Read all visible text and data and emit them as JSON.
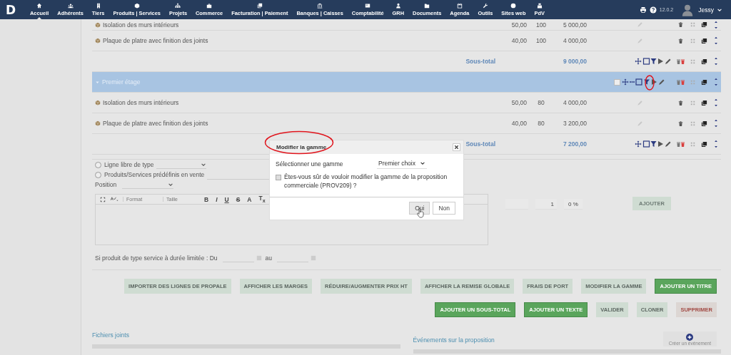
{
  "topbar": {
    "logo": "D",
    "menu": [
      {
        "label": "Accueil",
        "selected": true
      },
      {
        "label": "Adhérents",
        "selected": false
      },
      {
        "label": "Tiers",
        "selected": false
      },
      {
        "label": "Produits | Services",
        "selected": false
      },
      {
        "label": "Projets",
        "selected": false
      },
      {
        "label": "Commerce",
        "selected": false
      },
      {
        "label": "Facturation | Paiement",
        "selected": false
      },
      {
        "label": "Banques | Caisses",
        "selected": false
      },
      {
        "label": "Comptabilité",
        "selected": false
      },
      {
        "label": "GRH",
        "selected": false
      },
      {
        "label": "Documents",
        "selected": false
      },
      {
        "label": "Agenda",
        "selected": false
      },
      {
        "label": "Outils",
        "selected": false
      },
      {
        "label": "Sites web",
        "selected": false
      },
      {
        "label": "PdV",
        "selected": false
      }
    ],
    "version": "12.0.2",
    "user": "Jessy"
  },
  "table": {
    "rows": [
      {
        "kind": "product",
        "label": "Isolation des murs intérieurs",
        "qty": "50,00",
        "column_3": "100",
        "total": "5 000,00"
      },
      {
        "kind": "product",
        "label": "Plaque de platre avec finition des joints",
        "qty": "40,00",
        "column_3": "100",
        "total": "4 000,00"
      },
      {
        "kind": "subtotal",
        "label": "Sous-total",
        "total": "9 000,00"
      },
      {
        "kind": "title",
        "label": "Premier étage",
        "checked": false
      },
      {
        "kind": "product",
        "label": "Isolation des murs intérieurs",
        "qty": "50,00",
        "column_3": "80",
        "total": "4 000,00"
      },
      {
        "kind": "product",
        "label": "Plaque de platre avec finition des joints",
        "qty": "40,00",
        "column_3": "80",
        "total": "3 200,00"
      },
      {
        "kind": "subtotal",
        "label": "Sous-total",
        "total": "7 200,00"
      }
    ]
  },
  "add_line": {
    "line_types": [
      {
        "label": "Ligne libre de type",
        "selected": false
      },
      {
        "label": "Produits/Services prédéfinis en vente",
        "selected": false
      }
    ],
    "position_label": "Position",
    "editor": {
      "format": "Format",
      "size": "Taille",
      "tools": [
        "B",
        "I",
        "U",
        "S",
        "A",
        "T$_{x}$"
      ]
    },
    "qty": "1",
    "discount": "0 %",
    "add_button": "AJOUTER",
    "date_from_label": "Si produit de type service à durée limitée : Du",
    "date_to_label": "au"
  },
  "actions": [
    [
      {
        "label": "IMPORTER DES LIGNES DE PROPALE",
        "kind": "default"
      },
      {
        "label": "AFFICHER LES MARGES",
        "kind": "default"
      },
      {
        "label": "RÉDUIRE/AUGMENTER PRIX HT",
        "kind": "default"
      },
      {
        "label": "AFFICHER LA REMISE GLOBALE",
        "kind": "default"
      },
      {
        "label": "FRAIS DE PORT",
        "kind": "default"
      },
      {
        "label": "MODIFIER LA GAMME",
        "kind": "default"
      },
      {
        "label": "AJOUTER UN TITRE",
        "kind": "primary"
      }
    ],
    [
      {
        "label": "AJOUTER UN SOUS-TOTAL",
        "kind": "primary"
      },
      {
        "label": "AJOUTER UN TEXTE",
        "kind": "primary"
      },
      {
        "label": "VALIDER",
        "kind": "default"
      },
      {
        "label": "CLONER",
        "kind": "default"
      },
      {
        "label": "SUPPRIMER",
        "kind": "danger"
      }
    ]
  ],
  "sections": {
    "files": "Fichiers joints",
    "events": "Événements sur la proposition",
    "create_event": "Créer un événement"
  },
  "modal": {
    "title": "Modifier la gamme",
    "select_label": "Sélectionner une gamme",
    "select_value": "Premier choix",
    "confirm_checked": false,
    "confirm_text": "Êtes-vous sûr de vouloir modifier la gamme de la proposition commerciale (PROV209) ?",
    "buttons": [
      "Oui",
      "Non"
    ]
  }
}
